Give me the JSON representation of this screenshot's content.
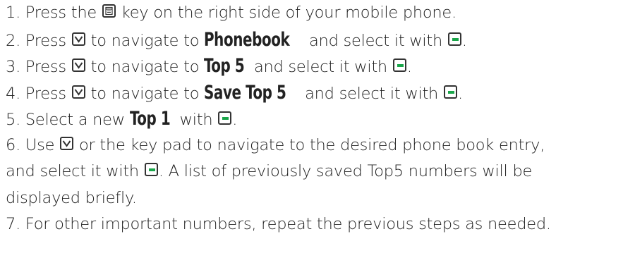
{
  "steps": [
    {
      "num": "1.",
      "a": "Press the",
      "b": "key on the right side of your mobile phone.",
      "icon": "menu-key-icon"
    },
    {
      "num": "2.",
      "a": "Press",
      "b": "to navigate to",
      "display": "Phonebook",
      "c": "and select it with",
      "d": "."
    },
    {
      "num": "3.",
      "a": "Press",
      "b": "to navigate to",
      "display": "Top 5",
      "c": "and select it with",
      "d": "."
    },
    {
      "num": "4.",
      "a": "Press",
      "b": "to navigate to",
      "display": "Save Top 5",
      "c": "and select it with",
      "d": "."
    },
    {
      "num": "5.",
      "a": "Select a new",
      "display": "Top 1",
      "b": "with",
      "d": "."
    },
    {
      "num": "6.",
      "a": "Use",
      "b": "or the key pad to navigate to the desired phone book entry,"
    },
    {
      "a": "and select it with",
      "b": ". A list of previously saved Top5 numbers will be"
    },
    {
      "a": "displayed briefly."
    },
    {
      "num": "7.",
      "a": "For other important numbers, repeat the previous steps as needed."
    }
  ],
  "colors": {
    "text": "#222222",
    "green_key": "#1aa64a",
    "icon_border": "#333333"
  }
}
